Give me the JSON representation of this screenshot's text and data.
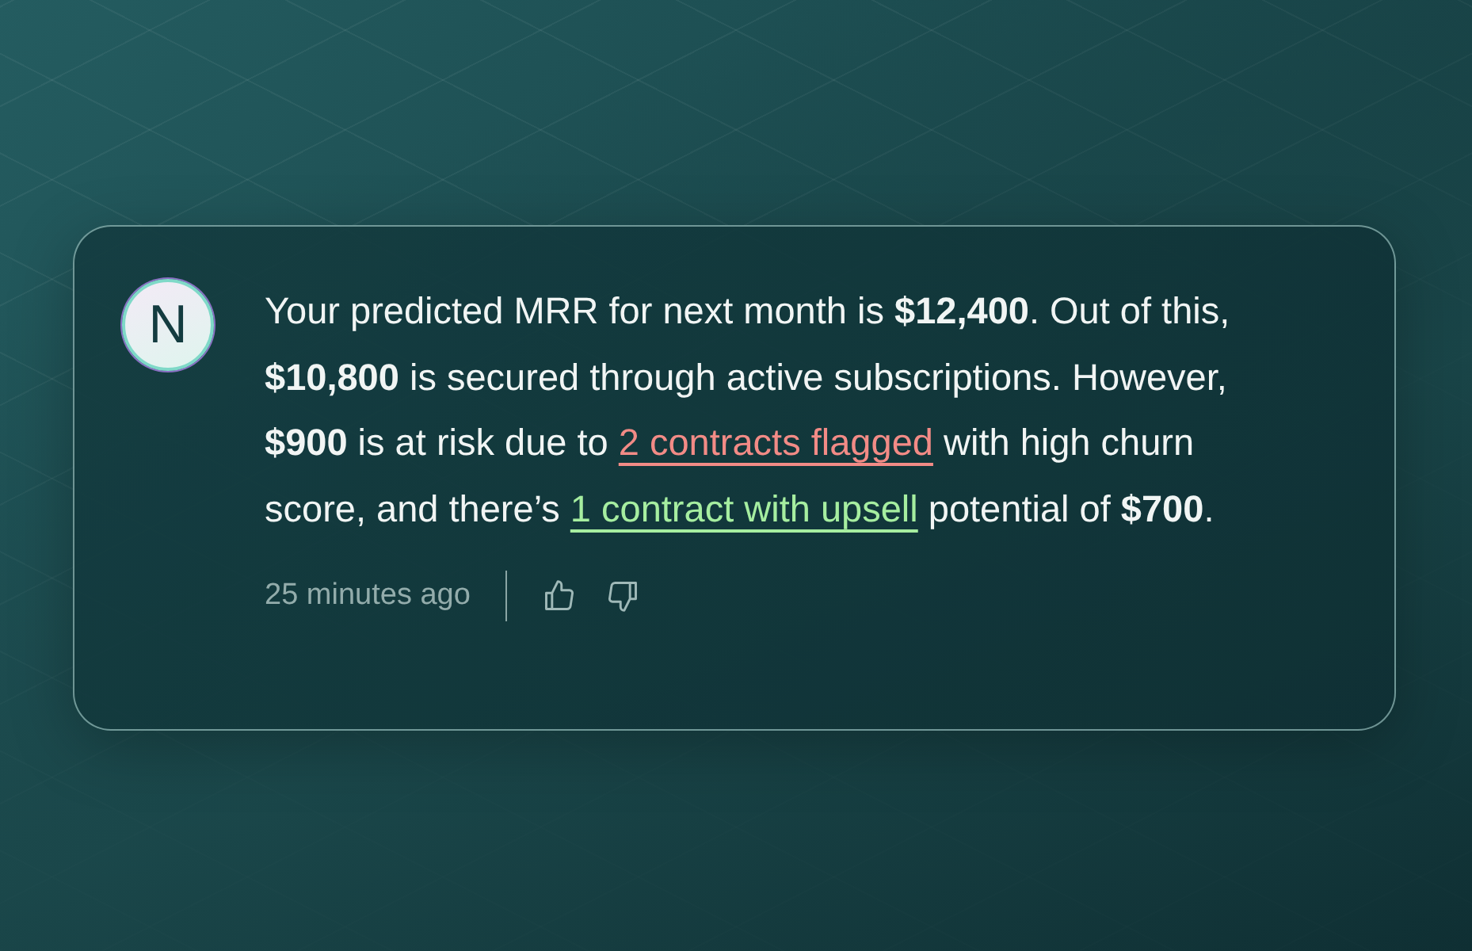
{
  "message": {
    "avatar": "N",
    "segments": [
      {
        "kind": "text",
        "text": "Your predicted MRR for next month is **$12,400**. Out of this, **$10,800** is secured through active subscriptions. However, **$900** is at risk due to "
      },
      {
        "kind": "link",
        "text": "2 contracts flagged",
        "color": "#f28b86"
      },
      {
        "kind": "text",
        "text": " with high churn score, and there’s "
      },
      {
        "kind": "link",
        "text": "1 contract with upsell",
        "color": "#a6eea0"
      },
      {
        "kind": "text",
        "text": " potential of **$700**."
      }
    ],
    "time": "25 minutes ago"
  }
}
